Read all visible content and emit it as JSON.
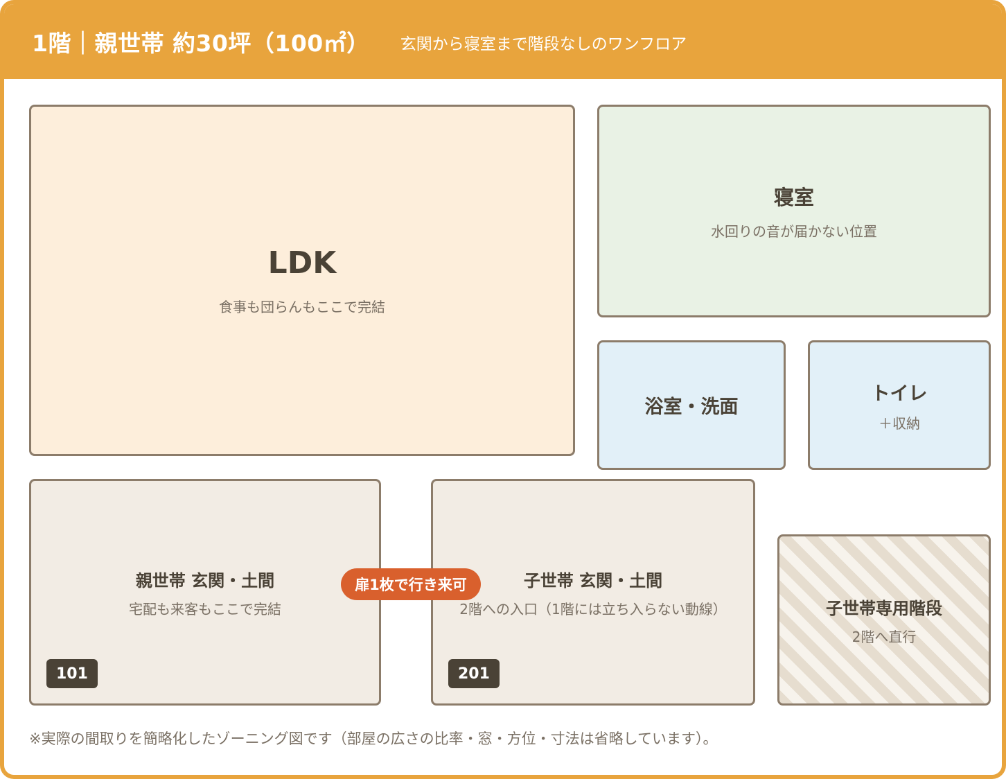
{
  "header": {
    "title": "1階｜親世帯 約30坪（100㎡）",
    "subtitle": "玄関から寝室まで階段なしのワンフロア"
  },
  "rooms": {
    "ldk": {
      "name": "LDK",
      "note": "食事も団らんもここで完結"
    },
    "bedroom": {
      "name": "寝室",
      "note": "水回りの音が届かない位置"
    },
    "bath": {
      "name": "浴室・洗面"
    },
    "toilet": {
      "name": "トイレ",
      "note": "＋収納"
    },
    "parent_entry": {
      "name": "親世帯 玄関・土間",
      "note": "宅配も来客もここで完結",
      "unit": "101"
    },
    "child_entry": {
      "name": "子世帯 玄関・土間",
      "note": "2階への入口（1階には立ち入らない動線）",
      "unit": "201"
    },
    "stairs": {
      "name": "子世帯専用階段",
      "note": "2階へ直行"
    }
  },
  "door_label": "扉1枚で行き来可",
  "footnote": "※実際の間取りを簡略化したゾーニング図です（部屋の広さの比率・窓・方位・寸法は省略しています）。",
  "colors": {
    "accent": "#e8a43d",
    "door": "#d9602d",
    "ldk": "#fdeedb",
    "bedroom": "#e9f2e5",
    "water": "#e2f0f8",
    "entry": "#f2ece4",
    "badge": "#4a4236"
  }
}
